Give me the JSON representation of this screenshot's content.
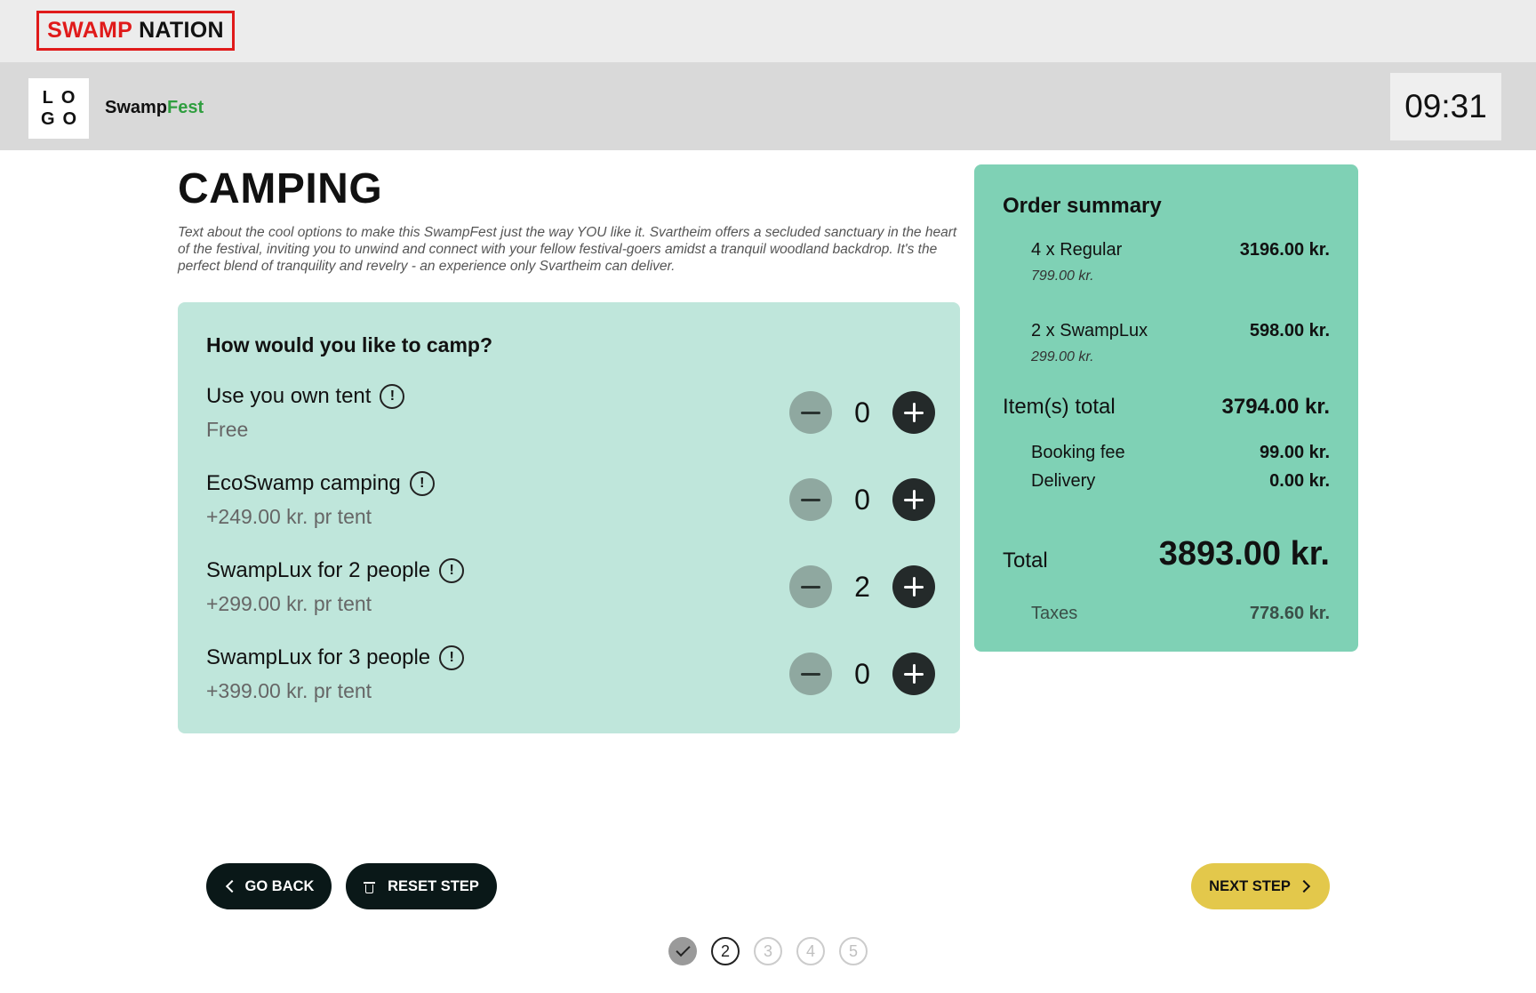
{
  "brand": {
    "part1": "SWAMP",
    "part2": "NATION",
    "accent": "#e01a1a"
  },
  "header": {
    "logo_line1": "LO",
    "logo_line2": "GO",
    "site_name_part1": "Swamp",
    "site_name_part2": "Fest",
    "clock": "09:31"
  },
  "page": {
    "title": "CAMPING",
    "intro": "Text about the cool options to make this SwampFest just the way YOU like it. Svartheim offers a secluded sanctuary in the heart of the festival, inviting you to unwind and connect with your fellow festival-goers amidst a tranquil woodland backdrop. It's the perfect blend of tranquility and revelry - an experience only Svartheim can deliver."
  },
  "camping": {
    "question": "How would you like to camp?",
    "options": [
      {
        "name": "Use you own tent",
        "price": "Free",
        "qty": "0"
      },
      {
        "name": "EcoSwamp camping",
        "price": "+249.00 kr. pr tent",
        "qty": "0"
      },
      {
        "name": "SwampLux for 2 people",
        "price": "+299.00 kr. pr tent",
        "qty": "2"
      },
      {
        "name": "SwampLux for 3 people",
        "price": "+399.00 kr. pr tent",
        "qty": "0"
      }
    ]
  },
  "summary": {
    "title": "Order summary",
    "items": [
      {
        "label": "4 x Regular",
        "unit": "799.00 kr.",
        "amount": "3196.00 kr."
      },
      {
        "label": "2 x SwampLux",
        "unit": "299.00 kr.",
        "amount": "598.00 kr."
      }
    ],
    "items_total_label": "Item(s) total",
    "items_total": "3794.00 kr.",
    "booking_fee_label": "Booking fee",
    "booking_fee": "99.00 kr.",
    "delivery_label": "Delivery",
    "delivery": "0.00 kr.",
    "total_label": "Total",
    "total": "3893.00 kr.",
    "taxes_label": "Taxes",
    "taxes": "778.60 kr."
  },
  "nav": {
    "go_back": "GO BACK",
    "reset_step": "RESET STEP",
    "next_step": "NEXT STEP"
  },
  "steps": [
    "2",
    "3",
    "4",
    "5"
  ],
  "colors": {
    "card_bg": "#bfe6db",
    "summary_bg": "#7fd1b5",
    "next_button": "#e3c84b",
    "dark_button": "#0a1818",
    "fest_green": "#2f9e3f"
  }
}
